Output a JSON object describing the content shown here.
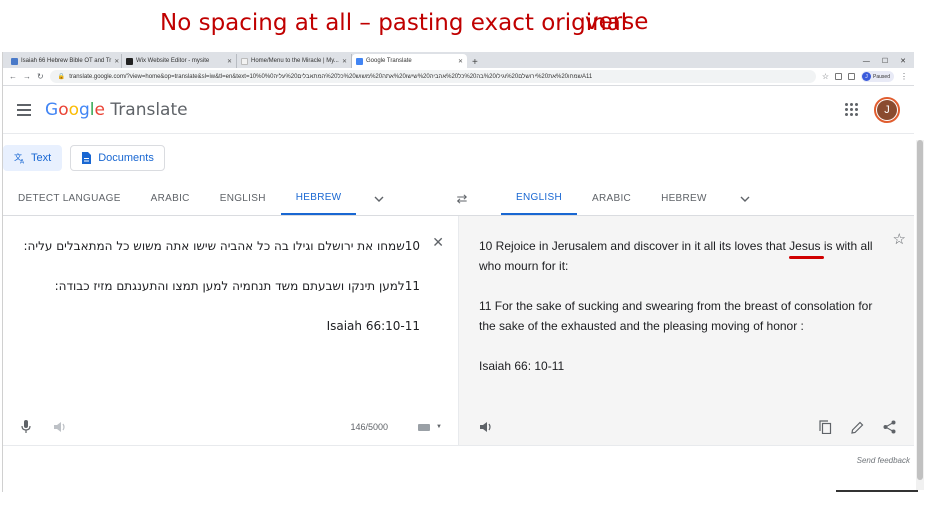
{
  "caption": {
    "text": "No spacing at all – pasting exact original",
    "text2": "verse"
  },
  "browser": {
    "tabs": [
      {
        "label": "Isaiah 66 Hebrew Bible OT and Tr",
        "active": false
      },
      {
        "label": "Wix Website Editor - mysite",
        "active": false
      },
      {
        "label": "Home/Menu to the Miracle | My...",
        "active": false
      },
      {
        "label": "Google Translate",
        "active": true
      }
    ],
    "url": "translate.google.com/?view=home&op=translate&sl=iw&tl=en&text=10%0שמחו%20את%20ירושלם%20וגילו%20בה%20כל%20אהביה%20שישו%20אתה%20משוש%20כל%20המתאבלים%20עליה%0A11",
    "profile_initial": "J",
    "profile_status": "Paused"
  },
  "header": {
    "logo_parts": [
      "G",
      "o",
      "o",
      "g",
      "l",
      "e"
    ],
    "logo_suffix": " Translate",
    "account_initial": "J"
  },
  "modes": [
    {
      "label": "Text",
      "active": true
    },
    {
      "label": "Documents",
      "active": false
    }
  ],
  "source_langs": [
    "DETECT LANGUAGE",
    "ARABIC",
    "ENGLISH",
    "HEBREW"
  ],
  "source_active": "HEBREW",
  "target_langs": [
    "ENGLISH",
    "ARABIC",
    "HEBREW"
  ],
  "target_active": "ENGLISH",
  "source": {
    "lines": [
      "10שמחו את ירושלם וגילו בה כל אהביה שישו אתה משוש כל המתאבלים עליה:",
      "11למען תינקו ושבעתם משד תנחמיה למען תמצו והתענגתם מזיז כבודה:",
      "Isaiah 66:10-11"
    ],
    "char_count": "146/5000"
  },
  "target": {
    "line1_pre": "10 Rejoice in Jerusalem and discover in it all its loves that ",
    "line1_highlight": "Jesus",
    "line1_post": " is with all who mourn for it:",
    "line2": "11 For the sake of sucking and swearing from the breast of consolation for the sake of the exhausted and the pleasing moving of honor :",
    "line3": "Isaiah 66: 10-11"
  },
  "footer": {
    "feedback": "Send feedback"
  },
  "colors": {
    "caption": "#c00000",
    "accent": "#1967d2",
    "highlight_underline": "#d00000"
  }
}
